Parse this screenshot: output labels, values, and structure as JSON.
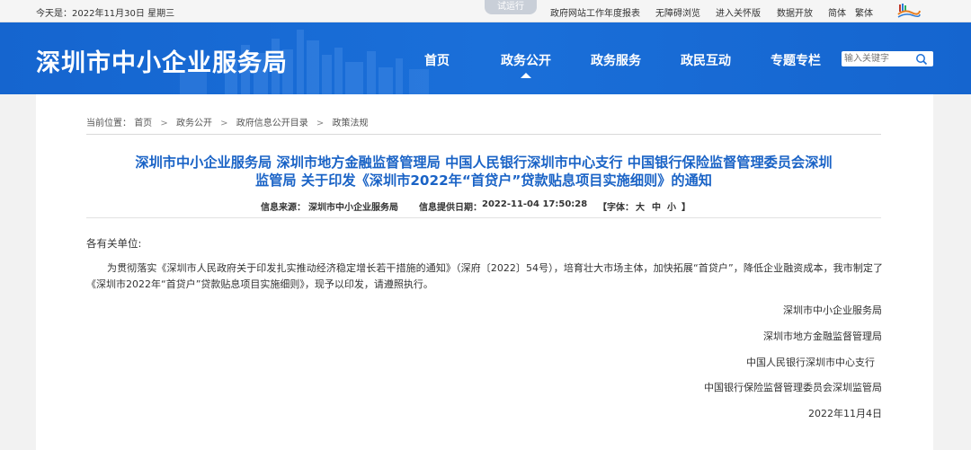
{
  "topbar": {
    "date": "今天是：2022年11月30日 星期三",
    "trial_badge": "试运行",
    "links": [
      "政府网站工作年度报表",
      "无障碍浏览",
      "进入关怀版",
      "数据开放",
      "简体",
      "繁体"
    ]
  },
  "header": {
    "site_title": "深圳市中小企业服务局",
    "nav": [
      "首页",
      "政务公开",
      "政务服务",
      "政民互动",
      "专题专栏"
    ],
    "active_nav": "政务公开",
    "search_placeholder": "输入关键字"
  },
  "breadcrumb": {
    "prefix": "当前位置：",
    "items": [
      "首页",
      "政务公开",
      "政府信息公开目录",
      "政策法规"
    ],
    "separator": ">"
  },
  "article": {
    "title_line1": "深圳市中小企业服务局 深圳市地方金融监督管理局 中国人民银行深圳市中心支行 中国银行保险监督管理委员会深圳",
    "title_line2": "监管局 关于印发《深圳市2022年“首贷户”贷款贴息项目实施细则》的通知",
    "source_label": "信息来源：",
    "source_value": "深圳市中小企业服务局",
    "date_label": "信息提供日期：",
    "date_value": "2022-11-04 17:50:28",
    "font_label": "【字体：",
    "font_large": "大",
    "font_medium": "中",
    "font_small": "小",
    "font_end": "】",
    "salutation": "各有关单位:",
    "body": "为贯彻落实《深圳市人民政府关于印发扎实推动经济稳定增长若干措施的通知》（深府〔2022〕54号），培育壮大市场主体，加快拓展“首贷户”，降低企业融资成本，我市制定了《深圳市2022年“首贷户”贷款贴息项目实施细则》，现予以印发，请遵照执行。",
    "signatures": [
      "深圳市中小企业服务局",
      "深圳市地方金融监督管理局",
      "中国人民银行深圳市中心支行",
      "中国银行保险监督管理委员会深圳监管局",
      "2022年11月4日"
    ]
  },
  "colors": {
    "header_blue": "#1a6fd9",
    "title_blue": "#1a63c6"
  }
}
